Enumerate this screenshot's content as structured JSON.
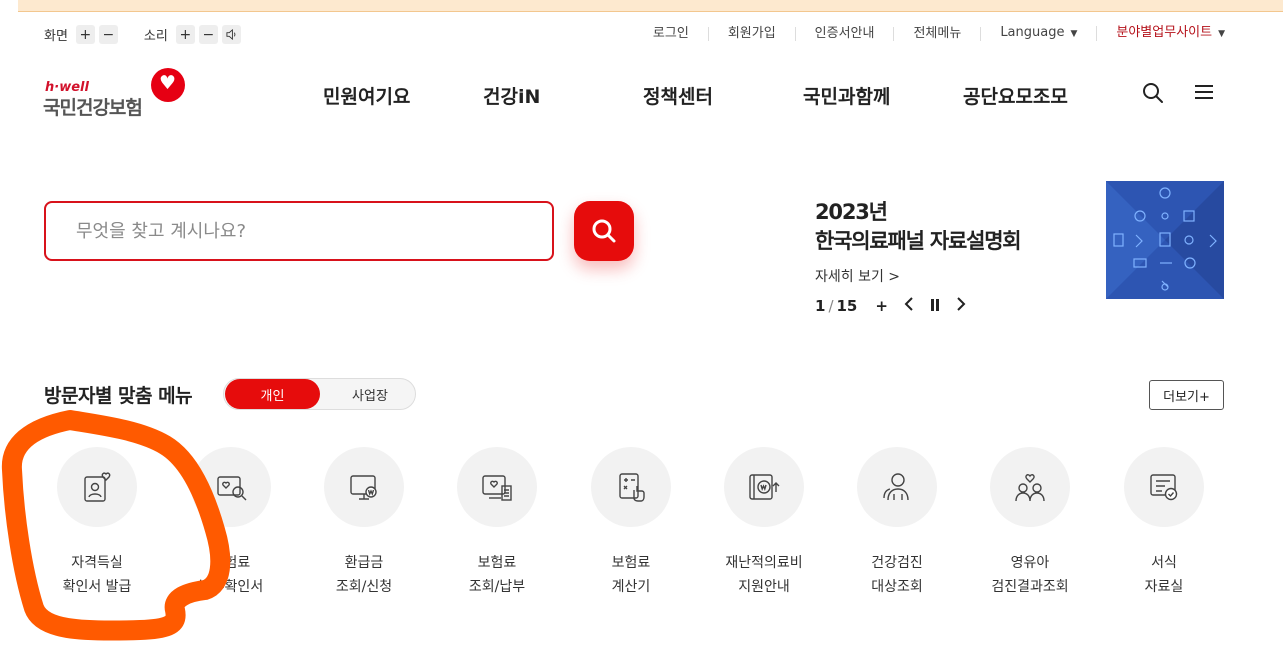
{
  "utility": {
    "screen_label": "화면",
    "sound_label": "소리",
    "plus": "+",
    "minus": "−",
    "links": [
      "로그인",
      "회원가입",
      "인증서안내",
      "전체메뉴"
    ],
    "language": "Language",
    "field_sites": "분야별업무사이트"
  },
  "logo": {
    "brand": "h·well",
    "name": "국민건강보험"
  },
  "gnb": [
    "민원여기요",
    "건강iN",
    "정책센터",
    "국민과함께",
    "공단요모조모"
  ],
  "search": {
    "placeholder": "무엇을 찾고 계시나요?"
  },
  "banner": {
    "title_line1": "2023년",
    "title_line2": "한국의료패널 자료설명회",
    "more": "자세히 보기 >",
    "current": "1",
    "separator": "/",
    "total": "15",
    "plus": "+"
  },
  "visitor_menu": {
    "title": "방문자별 맞춤 메뉴",
    "tab_personal": "개인",
    "tab_business": "사업장",
    "more": "더보기+",
    "items": [
      {
        "line1": "자격득실",
        "line2": "확인서 발급",
        "icon": "qualification-icon"
      },
      {
        "line1": "보험료",
        "line2": "납부확인서",
        "icon": "premium-certificate-icon"
      },
      {
        "line1": "환급금",
        "line2": "조회/신청",
        "icon": "refund-icon"
      },
      {
        "line1": "보험료",
        "line2": "조회/납부",
        "icon": "premium-payment-icon"
      },
      {
        "line1": "보험료",
        "line2": "계산기",
        "icon": "calculator-icon"
      },
      {
        "line1": "재난적의료비",
        "line2": "지원안내",
        "icon": "disaster-medical-icon"
      },
      {
        "line1": "건강검진",
        "line2": "대상조회",
        "icon": "health-checkup-icon"
      },
      {
        "line1": "영유아",
        "line2": "검진결과조회",
        "icon": "infant-checkup-icon"
      },
      {
        "line1": "서식",
        "line2": "자료실",
        "icon": "forms-icon"
      }
    ]
  },
  "colors": {
    "accent": "#e60c0c",
    "annotation": "#ff5a00"
  }
}
